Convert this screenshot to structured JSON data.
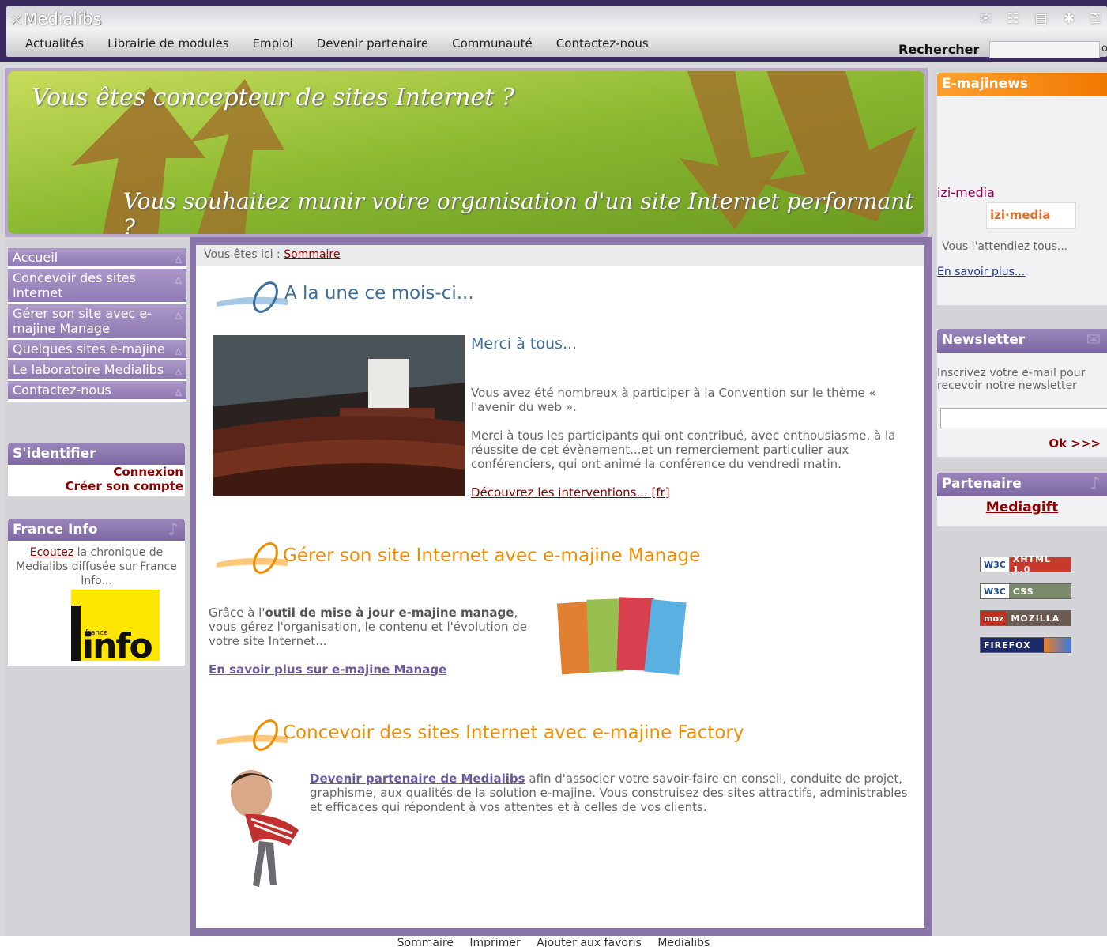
{
  "header": {
    "brand": "Medialibs",
    "nav": [
      "Actualités",
      "Librairie de modules",
      "Emploi",
      "Devenir partenaire",
      "Communauté",
      "Contactez-nous"
    ],
    "search_label": "Rechercher",
    "search_value": ""
  },
  "banner": {
    "line1": "Vous êtes concepteur de sites Internet ?",
    "line2": "Vous souhaitez munir votre organisation d'un site Internet performant ?"
  },
  "left_menu": [
    "Accueil",
    "Concevoir des sites Internet",
    "Gérer son site avec e-majine Manage",
    "Quelques sites e-majine",
    "Le laboratoire Medialibs",
    "Contactez-nous"
  ],
  "login": {
    "title": "S'identifier",
    "connexion": "Connexion",
    "create": "Créer son compte"
  },
  "france_info": {
    "title": "France Info",
    "link": "Ecoutez",
    "text": " la chronique de Medialibs diffusée sur France Info...",
    "logo_small": "france",
    "logo_big": "info"
  },
  "breadcrumb": {
    "prefix": "Vous êtes ici : ",
    "current": "Sommaire"
  },
  "sections": {
    "une_title": "A la une ce mois-ci...",
    "news_title": "Merci à tous...",
    "news_p1": "Vous avez été nombreux à participer à la Convention sur le thème « l'avenir du web ».",
    "news_p2": "Merci à tous les participants qui ont contribué, avec enthousiasme, à la réussite de cet évènement...et un remerciement particulier aux conférenciers, qui ont animé la conférence du vendredi matin.",
    "news_link": "Découvrez les interventions... [fr]",
    "manage_title": "Gérer son site Internet avec e-majine Manage",
    "manage_pre": "Grâce à l'",
    "manage_bold": "outil de mise à jour e-majine manage",
    "manage_post": ", vous gérez l'organisation, le contenu et l'évolution de votre site Internet...",
    "manage_link": "En savoir plus sur e-majine Manage",
    "factory_title": "Concevoir des sites Internet avec e-majine Factory",
    "factory_link": "Devenir partenaire de Medialibs",
    "factory_text": " afin d'associer votre savoir-faire en conseil, conduite de projet, graphisme, aux qualités de la solution e-majine. Vous construisez des sites attractifs, administrables et efficaces qui répondent à vos attentes et à celles de vos clients."
  },
  "right": {
    "emajinews_title": "E-majinews",
    "izi_label": "izi-media",
    "izi_logo": "izi·media",
    "izi_desc": "Vous l'attendiez tous...",
    "izi_link": "En savoir plus...",
    "newsletter_title": "Newsletter",
    "newsletter_desc": "Inscrivez votre e-mail pour recevoir notre newsletter",
    "newsletter_ok": "Ok >>>",
    "partner_title": "Partenaire",
    "partner_link": "Mediagift",
    "badges": [
      {
        "left": "W3C",
        "right": "XHTML 1.0"
      },
      {
        "left": "W3C",
        "right": "CSS"
      },
      {
        "left": "moz",
        "right": "MOZILLA"
      },
      {
        "left": "",
        "right": "FIREFOX"
      }
    ]
  },
  "footer": [
    "Sommaire",
    "Imprimer",
    "Ajouter aux favoris",
    "Medialibs"
  ],
  "colors": {
    "purple": "#8a75a8",
    "dark_purple": "#3a2a5e",
    "orange": "#f08c00",
    "dark_red": "#8b0000"
  }
}
